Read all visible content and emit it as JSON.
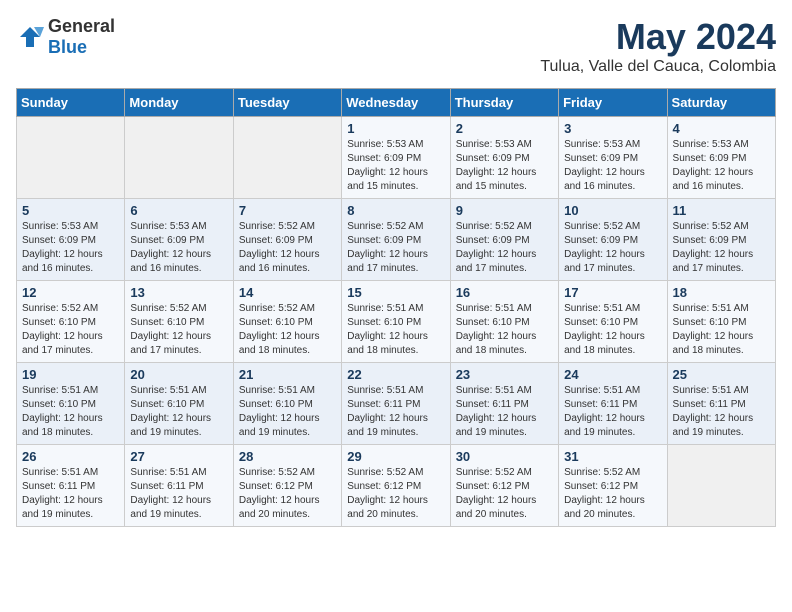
{
  "logo": {
    "text_general": "General",
    "text_blue": "Blue"
  },
  "title": {
    "month": "May 2024",
    "location": "Tulua, Valle del Cauca, Colombia"
  },
  "headers": [
    "Sunday",
    "Monday",
    "Tuesday",
    "Wednesday",
    "Thursday",
    "Friday",
    "Saturday"
  ],
  "weeks": [
    [
      {
        "day": "",
        "info": ""
      },
      {
        "day": "",
        "info": ""
      },
      {
        "day": "",
        "info": ""
      },
      {
        "day": "1",
        "info": "Sunrise: 5:53 AM\nSunset: 6:09 PM\nDaylight: 12 hours\nand 15 minutes."
      },
      {
        "day": "2",
        "info": "Sunrise: 5:53 AM\nSunset: 6:09 PM\nDaylight: 12 hours\nand 15 minutes."
      },
      {
        "day": "3",
        "info": "Sunrise: 5:53 AM\nSunset: 6:09 PM\nDaylight: 12 hours\nand 16 minutes."
      },
      {
        "day": "4",
        "info": "Sunrise: 5:53 AM\nSunset: 6:09 PM\nDaylight: 12 hours\nand 16 minutes."
      }
    ],
    [
      {
        "day": "5",
        "info": "Sunrise: 5:53 AM\nSunset: 6:09 PM\nDaylight: 12 hours\nand 16 minutes."
      },
      {
        "day": "6",
        "info": "Sunrise: 5:53 AM\nSunset: 6:09 PM\nDaylight: 12 hours\nand 16 minutes."
      },
      {
        "day": "7",
        "info": "Sunrise: 5:52 AM\nSunset: 6:09 PM\nDaylight: 12 hours\nand 16 minutes."
      },
      {
        "day": "8",
        "info": "Sunrise: 5:52 AM\nSunset: 6:09 PM\nDaylight: 12 hours\nand 17 minutes."
      },
      {
        "day": "9",
        "info": "Sunrise: 5:52 AM\nSunset: 6:09 PM\nDaylight: 12 hours\nand 17 minutes."
      },
      {
        "day": "10",
        "info": "Sunrise: 5:52 AM\nSunset: 6:09 PM\nDaylight: 12 hours\nand 17 minutes."
      },
      {
        "day": "11",
        "info": "Sunrise: 5:52 AM\nSunset: 6:09 PM\nDaylight: 12 hours\nand 17 minutes."
      }
    ],
    [
      {
        "day": "12",
        "info": "Sunrise: 5:52 AM\nSunset: 6:10 PM\nDaylight: 12 hours\nand 17 minutes."
      },
      {
        "day": "13",
        "info": "Sunrise: 5:52 AM\nSunset: 6:10 PM\nDaylight: 12 hours\nand 17 minutes."
      },
      {
        "day": "14",
        "info": "Sunrise: 5:52 AM\nSunset: 6:10 PM\nDaylight: 12 hours\nand 18 minutes."
      },
      {
        "day": "15",
        "info": "Sunrise: 5:51 AM\nSunset: 6:10 PM\nDaylight: 12 hours\nand 18 minutes."
      },
      {
        "day": "16",
        "info": "Sunrise: 5:51 AM\nSunset: 6:10 PM\nDaylight: 12 hours\nand 18 minutes."
      },
      {
        "day": "17",
        "info": "Sunrise: 5:51 AM\nSunset: 6:10 PM\nDaylight: 12 hours\nand 18 minutes."
      },
      {
        "day": "18",
        "info": "Sunrise: 5:51 AM\nSunset: 6:10 PM\nDaylight: 12 hours\nand 18 minutes."
      }
    ],
    [
      {
        "day": "19",
        "info": "Sunrise: 5:51 AM\nSunset: 6:10 PM\nDaylight: 12 hours\nand 18 minutes."
      },
      {
        "day": "20",
        "info": "Sunrise: 5:51 AM\nSunset: 6:10 PM\nDaylight: 12 hours\nand 19 minutes."
      },
      {
        "day": "21",
        "info": "Sunrise: 5:51 AM\nSunset: 6:10 PM\nDaylight: 12 hours\nand 19 minutes."
      },
      {
        "day": "22",
        "info": "Sunrise: 5:51 AM\nSunset: 6:11 PM\nDaylight: 12 hours\nand 19 minutes."
      },
      {
        "day": "23",
        "info": "Sunrise: 5:51 AM\nSunset: 6:11 PM\nDaylight: 12 hours\nand 19 minutes."
      },
      {
        "day": "24",
        "info": "Sunrise: 5:51 AM\nSunset: 6:11 PM\nDaylight: 12 hours\nand 19 minutes."
      },
      {
        "day": "25",
        "info": "Sunrise: 5:51 AM\nSunset: 6:11 PM\nDaylight: 12 hours\nand 19 minutes."
      }
    ],
    [
      {
        "day": "26",
        "info": "Sunrise: 5:51 AM\nSunset: 6:11 PM\nDaylight: 12 hours\nand 19 minutes."
      },
      {
        "day": "27",
        "info": "Sunrise: 5:51 AM\nSunset: 6:11 PM\nDaylight: 12 hours\nand 19 minutes."
      },
      {
        "day": "28",
        "info": "Sunrise: 5:52 AM\nSunset: 6:12 PM\nDaylight: 12 hours\nand 20 minutes."
      },
      {
        "day": "29",
        "info": "Sunrise: 5:52 AM\nSunset: 6:12 PM\nDaylight: 12 hours\nand 20 minutes."
      },
      {
        "day": "30",
        "info": "Sunrise: 5:52 AM\nSunset: 6:12 PM\nDaylight: 12 hours\nand 20 minutes."
      },
      {
        "day": "31",
        "info": "Sunrise: 5:52 AM\nSunset: 6:12 PM\nDaylight: 12 hours\nand 20 minutes."
      },
      {
        "day": "",
        "info": ""
      }
    ]
  ]
}
